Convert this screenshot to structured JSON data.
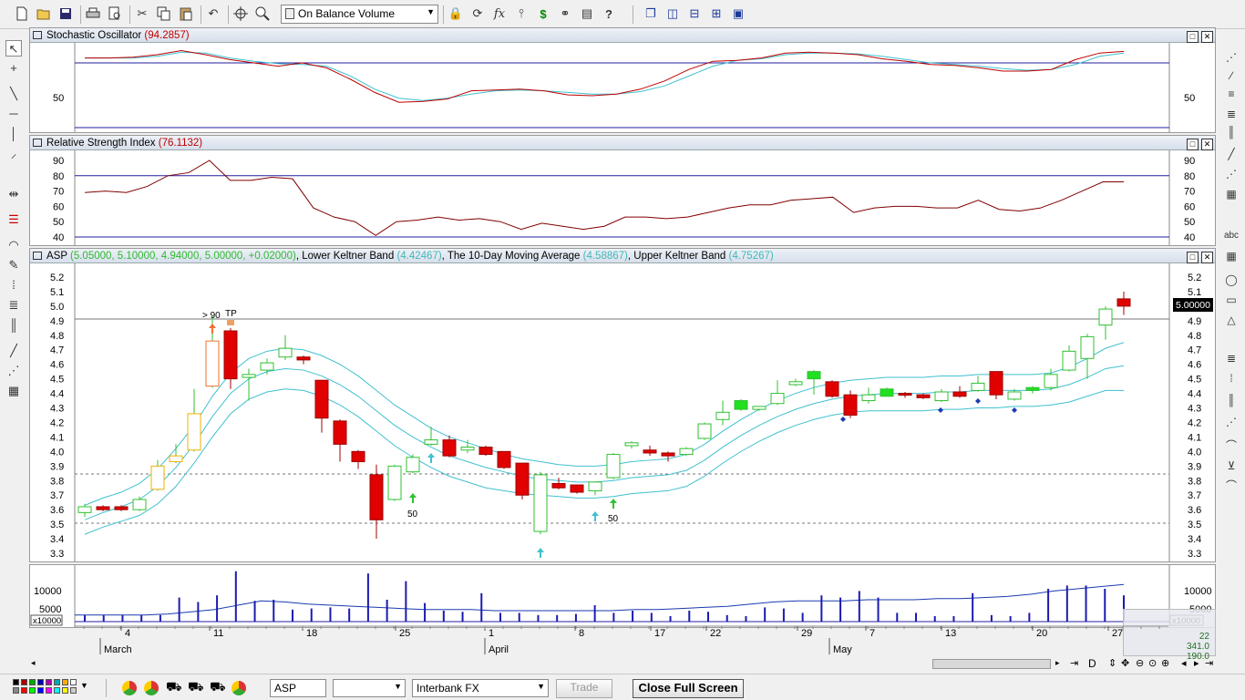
{
  "toolbar": {
    "indicator_select": "On Balance Volume",
    "icons": [
      "new-icon",
      "open-icon",
      "save-icon",
      "print-icon",
      "print-preview-icon",
      "cut-icon",
      "copy-icon",
      "paste-icon",
      "undo-icon",
      "crosshair-icon",
      "zoom-icon",
      "lock-icon",
      "cycle-icon",
      "formula-icon",
      "stock-chart-icon",
      "dollar-icon",
      "binoculars-icon",
      "properties-icon",
      "help-icon",
      "cascade-icon",
      "tile-vertical-icon",
      "tile-horizontal-icon",
      "tile-grid-icon",
      "snapshot-icon"
    ]
  },
  "stochastic": {
    "title": "Stochastic Oscillator",
    "value": "(94.2857)",
    "axis_left": "50",
    "axis_right": "50"
  },
  "rsi": {
    "title": "Relative Strength Index",
    "value": "(76.1132)",
    "ticks": [
      "90",
      "80",
      "70",
      "60",
      "50",
      "40"
    ]
  },
  "price": {
    "symbol": "ASP",
    "ohlc": "(5.05000, 5.10000, 4.94000, 5.00000, +0.02000)",
    "sep1": ",",
    "lower_label": "Lower Keltner Band",
    "lower_value": "(4.42467)",
    "sep2": ",",
    "ma_label": "The 10-Day Moving Average",
    "ma_value": "(4.58867)",
    "sep3": ",",
    "upper_label": "Upper Keltner Band",
    "upper_value": "(4.75267)",
    "ticks": [
      "5.2",
      "5.1",
      "5.0",
      "4.9",
      "4.8",
      "4.7",
      "4.6",
      "4.5",
      "4.4",
      "4.3",
      "4.2",
      "4.1",
      "4.0",
      "3.9",
      "3.8",
      "3.7",
      "3.6",
      "3.5",
      "3.4",
      "3.3"
    ],
    "last_price": "5.00000",
    "annotations": {
      "gt90": "> 90",
      "tp": "TP",
      "fifty1": "50",
      "fifty2": "50"
    }
  },
  "volume": {
    "ticks": [
      "10000",
      "5000"
    ],
    "multiplier": "x10000",
    "overlay": [
      "22",
      "341.0",
      "190.0"
    ]
  },
  "xaxis": {
    "days": [
      "4",
      "11",
      "18",
      "25",
      "1",
      "8",
      "17",
      "22",
      "29",
      "7",
      "13",
      "20",
      "27"
    ],
    "months": [
      "March",
      "April",
      "May"
    ]
  },
  "bottom": {
    "symbol": "ASP",
    "period": "",
    "feed": "Interbank FX",
    "trade": "Trade",
    "close": "Close Full Screen",
    "nav": "D"
  },
  "chart_data": {
    "type": "candlestick",
    "y_range": [
      3.25,
      5.25
    ],
    "candles": [
      {
        "o": 3.58,
        "c": 3.62,
        "h": 3.64,
        "l": 3.55
      },
      {
        "o": 3.62,
        "c": 3.6,
        "h": 3.63,
        "l": 3.59
      },
      {
        "o": 3.62,
        "c": 3.6,
        "h": 3.63,
        "l": 3.59
      },
      {
        "o": 3.6,
        "c": 3.67,
        "h": 3.69,
        "l": 3.59
      },
      {
        "o": 3.74,
        "c": 3.9,
        "h": 3.94,
        "l": 3.73
      },
      {
        "o": 3.93,
        "c": 3.97,
        "h": 4.05,
        "l": 3.92
      },
      {
        "o": 4.01,
        "c": 4.26,
        "h": 4.43,
        "l": 4.0
      },
      {
        "o": 4.45,
        "c": 4.76,
        "h": 4.93,
        "l": 4.44
      },
      {
        "o": 4.83,
        "c": 4.5,
        "h": 4.85,
        "l": 4.43
      },
      {
        "o": 4.51,
        "c": 4.53,
        "h": 4.57,
        "l": 4.35
      },
      {
        "o": 4.56,
        "c": 4.61,
        "h": 4.64,
        "l": 4.53
      },
      {
        "o": 4.65,
        "c": 4.71,
        "h": 4.8,
        "l": 4.63
      },
      {
        "o": 4.65,
        "c": 4.63,
        "h": 4.66,
        "l": 4.6
      },
      {
        "o": 4.49,
        "c": 4.23,
        "h": 4.49,
        "l": 4.13
      },
      {
        "o": 4.21,
        "c": 4.05,
        "h": 4.22,
        "l": 3.93
      },
      {
        "o": 4.0,
        "c": 3.93,
        "h": 4.01,
        "l": 3.88
      },
      {
        "o": 3.84,
        "c": 3.53,
        "h": 3.91,
        "l": 3.4
      },
      {
        "o": 3.67,
        "c": 3.9,
        "h": 3.91,
        "l": 3.66
      },
      {
        "o": 3.86,
        "c": 3.96,
        "h": 3.98,
        "l": 3.85
      },
      {
        "o": 4.05,
        "c": 4.08,
        "h": 4.17,
        "l": 4.04
      },
      {
        "o": 4.08,
        "c": 3.97,
        "h": 4.11,
        "l": 3.96
      },
      {
        "o": 4.01,
        "c": 4.03,
        "h": 4.08,
        "l": 3.99
      },
      {
        "o": 4.03,
        "c": 3.98,
        "h": 4.04,
        "l": 3.97
      },
      {
        "o": 4.0,
        "c": 3.89,
        "h": 4.0,
        "l": 3.88
      },
      {
        "o": 3.92,
        "c": 3.7,
        "h": 3.92,
        "l": 3.67
      },
      {
        "o": 3.45,
        "c": 3.84,
        "h": 3.86,
        "l": 3.43
      },
      {
        "o": 3.78,
        "c": 3.75,
        "h": 3.82,
        "l": 3.74
      },
      {
        "o": 3.77,
        "c": 3.72,
        "h": 3.77,
        "l": 3.71
      },
      {
        "o": 3.73,
        "c": 3.79,
        "h": 3.79,
        "l": 3.7
      },
      {
        "o": 3.82,
        "c": 3.98,
        "h": 3.99,
        "l": 3.81
      },
      {
        "o": 4.04,
        "c": 4.06,
        "h": 4.07,
        "l": 4.02
      },
      {
        "o": 4.01,
        "c": 3.99,
        "h": 4.04,
        "l": 3.97
      },
      {
        "o": 3.99,
        "c": 3.97,
        "h": 4.0,
        "l": 3.93
      },
      {
        "o": 3.98,
        "c": 4.02,
        "h": 4.03,
        "l": 3.97
      },
      {
        "o": 4.09,
        "c": 4.19,
        "h": 4.2,
        "l": 4.08
      },
      {
        "o": 4.22,
        "c": 4.27,
        "h": 4.35,
        "l": 4.18
      },
      {
        "o": 4.29,
        "c": 4.35,
        "h": 4.36,
        "l": 4.28
      },
      {
        "o": 4.29,
        "c": 4.31,
        "h": 4.31,
        "l": 4.28
      },
      {
        "o": 4.33,
        "c": 4.4,
        "h": 4.49,
        "l": 4.32
      },
      {
        "o": 4.46,
        "c": 4.48,
        "h": 4.5,
        "l": 4.45
      },
      {
        "o": 4.5,
        "c": 4.55,
        "h": 4.56,
        "l": 4.39
      },
      {
        "o": 4.48,
        "c": 4.38,
        "h": 4.49,
        "l": 4.37
      },
      {
        "o": 4.39,
        "c": 4.25,
        "h": 4.42,
        "l": 4.23
      },
      {
        "o": 4.35,
        "c": 4.39,
        "h": 4.44,
        "l": 4.33
      },
      {
        "o": 4.38,
        "c": 4.43,
        "h": 4.44,
        "l": 4.38
      },
      {
        "o": 4.4,
        "c": 4.39,
        "h": 4.41,
        "l": 4.37
      },
      {
        "o": 4.39,
        "c": 4.37,
        "h": 4.4,
        "l": 4.36
      },
      {
        "o": 4.35,
        "c": 4.41,
        "h": 4.43,
        "l": 4.34
      },
      {
        "o": 4.41,
        "c": 4.38,
        "h": 4.45,
        "l": 4.37
      },
      {
        "o": 4.42,
        "c": 4.47,
        "h": 4.52,
        "l": 4.41
      },
      {
        "o": 4.55,
        "c": 4.39,
        "h": 4.55,
        "l": 4.36
      },
      {
        "o": 4.36,
        "c": 4.41,
        "h": 4.43,
        "l": 4.35
      },
      {
        "o": 4.42,
        "c": 4.44,
        "h": 4.45,
        "l": 4.4
      },
      {
        "o": 4.44,
        "c": 4.53,
        "h": 4.57,
        "l": 4.42
      },
      {
        "o": 4.56,
        "c": 4.69,
        "h": 4.73,
        "l": 4.55
      },
      {
        "o": 4.64,
        "c": 4.79,
        "h": 4.81,
        "l": 4.5
      },
      {
        "o": 4.87,
        "c": 4.98,
        "h": 5.0,
        "l": 4.77
      },
      {
        "o": 5.05,
        "c": 5.0,
        "h": 5.1,
        "l": 4.94
      }
    ],
    "upper_band": [
      3.63,
      3.68,
      3.72,
      3.78,
      3.88,
      4.02,
      4.18,
      4.38,
      4.54,
      4.64,
      4.69,
      4.71,
      4.7,
      4.66,
      4.6,
      4.52,
      4.42,
      4.32,
      4.24,
      4.16,
      4.1,
      4.06,
      4.02,
      3.98,
      3.95,
      3.93,
      3.91,
      3.9,
      3.9,
      3.91,
      3.93,
      3.94,
      3.95,
      3.98,
      4.05,
      4.14,
      4.22,
      4.29,
      4.35,
      4.4,
      4.44,
      4.47,
      4.49,
      4.5,
      4.51,
      4.51,
      4.51,
      4.52,
      4.52,
      4.53,
      4.53,
      4.53,
      4.53,
      4.54,
      4.58,
      4.64,
      4.71,
      4.75
    ],
    "ma": [
      3.53,
      3.58,
      3.62,
      3.67,
      3.76,
      3.89,
      4.05,
      4.24,
      4.4,
      4.5,
      4.55,
      4.57,
      4.56,
      4.52,
      4.46,
      4.38,
      4.28,
      4.18,
      4.1,
      4.03,
      3.97,
      3.93,
      3.89,
      3.86,
      3.83,
      3.81,
      3.8,
      3.79,
      3.79,
      3.8,
      3.82,
      3.83,
      3.84,
      3.87,
      3.94,
      4.03,
      4.11,
      4.18,
      4.24,
      4.29,
      4.33,
      4.36,
      4.38,
      4.39,
      4.4,
      4.4,
      4.4,
      4.41,
      4.41,
      4.42,
      4.42,
      4.42,
      4.42,
      4.43,
      4.46,
      4.51,
      4.57,
      4.59
    ],
    "lower_band": [
      3.43,
      3.48,
      3.52,
      3.56,
      3.64,
      3.76,
      3.92,
      4.1,
      4.26,
      4.36,
      4.41,
      4.43,
      4.42,
      4.38,
      4.32,
      4.24,
      4.14,
      4.04,
      3.96,
      3.89,
      3.83,
      3.79,
      3.75,
      3.73,
      3.71,
      3.7,
      3.69,
      3.68,
      3.68,
      3.69,
      3.71,
      3.72,
      3.73,
      3.76,
      3.83,
      3.92,
      4.0,
      4.07,
      4.13,
      4.18,
      4.22,
      4.25,
      4.27,
      4.28,
      4.28,
      4.28,
      4.28,
      4.29,
      4.29,
      4.3,
      4.3,
      4.31,
      4.31,
      4.32,
      4.34,
      4.38,
      4.42,
      4.42
    ],
    "stoch_k": [
      86,
      86,
      87,
      90,
      95,
      90,
      84,
      80,
      76,
      80,
      74,
      60,
      44,
      32,
      33,
      36,
      46,
      47,
      48,
      46,
      41,
      40,
      42,
      48,
      58,
      72,
      82,
      83,
      86,
      92,
      93,
      92,
      90,
      85,
      82,
      78,
      77,
      74,
      70,
      70,
      72,
      84,
      92,
      94
    ],
    "stoch_d": [
      86,
      86,
      86,
      88,
      93,
      92,
      86,
      82,
      79,
      78,
      76,
      64,
      48,
      37,
      34,
      37,
      42,
      46,
      47,
      46,
      44,
      42,
      42,
      45,
      52,
      64,
      76,
      83,
      85,
      90,
      92,
      92,
      91,
      88,
      84,
      80,
      78,
      76,
      73,
      71,
      72,
      78,
      88,
      92
    ],
    "rsi": [
      69,
      70,
      69,
      73,
      80,
      82,
      90,
      77,
      77,
      79,
      78,
      59,
      53,
      50,
      41,
      50,
      51,
      53,
      51,
      52,
      50,
      45,
      49,
      47,
      45,
      47,
      53,
      53,
      52,
      53,
      56,
      59,
      61,
      61,
      64,
      65,
      66,
      56,
      59,
      60,
      60,
      59,
      59,
      64,
      58,
      57,
      59,
      64,
      70,
      76,
      76
    ],
    "volume_bars": [
      0.6,
      0.6,
      0.6,
      0.6,
      0.6,
      2.2,
      1.8,
      2.4,
      4.6,
      1.9,
      2.0,
      1.1,
      1.2,
      1.3,
      1.2,
      4.4,
      2.0,
      3.7,
      1.7,
      1.0,
      0.9,
      2.6,
      0.8,
      0.8,
      0.6,
      0.6,
      0.7,
      1.5,
      0.8,
      1.0,
      0.8,
      0.5,
      1.0,
      0.9,
      0.6,
      0.5,
      1.3,
      1.2,
      0.8,
      2.4,
      2.2,
      2.8,
      2.2,
      0.8,
      0.8,
      0.5,
      0.5,
      2.6,
      0.6,
      0.5,
      0.8,
      3.0,
      3.3,
      3.3,
      3.0,
      2.4
    ],
    "obv_line": [
      0.6,
      0.6,
      0.6,
      0.6,
      0.7,
      0.9,
      1.1,
      1.5,
      1.9,
      1.8,
      1.6,
      1.5,
      1.4,
      1.3,
      1.2,
      1.1,
      1.1,
      1.1,
      1.0,
      1.0,
      1.0,
      1.0,
      1.0,
      1.0,
      1.1,
      1.1,
      1.2,
      1.3,
      1.4,
      1.6,
      1.8,
      1.9,
      1.9,
      1.9,
      2.0,
      2.0,
      2.0,
      2.1,
      2.1,
      2.2,
      2.3,
      2.5,
      2.8,
      3.0,
      3.2,
      3.4
    ]
  }
}
